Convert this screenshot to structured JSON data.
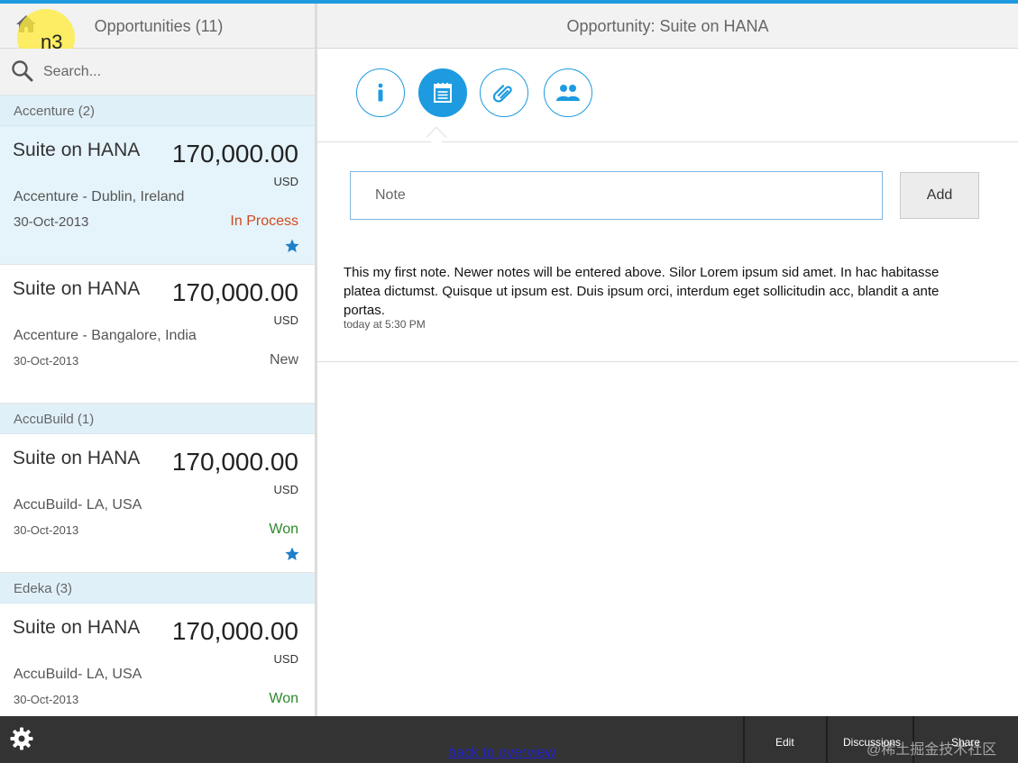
{
  "master": {
    "title": "Opportunities (11)",
    "badge": "n3",
    "search_placeholder": "Search...",
    "groups": [
      {
        "header": "Accenture (2)",
        "items": [
          {
            "title": "Suite on HANA",
            "amount": "170,000.00",
            "currency": "USD",
            "location": "Accenture - Dublin, Ireland",
            "date": "30-Oct-2013",
            "status": "In Process",
            "favorite": true
          },
          {
            "title": "Suite on HANA",
            "amount": "170,000.00",
            "currency": "USD",
            "location": "Accenture - Bangalore, India",
            "date": "30-Oct-2013",
            "status": "New",
            "favorite": false
          }
        ]
      },
      {
        "header": "AccuBuild (1)",
        "items": [
          {
            "title": "Suite on HANA",
            "amount": "170,000.00",
            "currency": "USD",
            "location": "AccuBuild- LA, USA",
            "date": "30-Oct-2013",
            "status": "Won",
            "favorite": true
          }
        ]
      },
      {
        "header": "Edeka (3)",
        "items": [
          {
            "title": "Suite on HANA",
            "amount": "170,000.00",
            "currency": "USD",
            "location": "AccuBuild- LA, USA",
            "date": "30-Oct-2013",
            "status": "Won",
            "favorite": false
          }
        ]
      }
    ]
  },
  "detail": {
    "title": "Opportunity: Suite on HANA",
    "tabs": [
      {
        "icon": "info-icon",
        "active": false
      },
      {
        "icon": "notes-icon",
        "active": true
      },
      {
        "icon": "attachment-icon",
        "active": false
      },
      {
        "icon": "contacts-icon",
        "active": false
      }
    ],
    "note_placeholder": "Note",
    "add_label": "Add",
    "notes": [
      {
        "text": "This my first note. Newer notes will be entered above. Silor Lorem ipsum sid amet. In hac habitasse platea dictumst. Quisque ut ipsum est. Duis ipsum orci, interdum eget sollicitudin acc, blandit a ante portas.",
        "time": "today at 5:30 PM"
      }
    ]
  },
  "footer": {
    "back_link": "back to overview",
    "buttons": [
      "Edit",
      "Discussions",
      "Share"
    ],
    "watermark": "@稀土掘金技术社区"
  },
  "colors": {
    "accent": "#1e9be0",
    "selected_row": "#e5f3fa",
    "group_header": "#e0f0f9",
    "status_in_process": "#d14b1d",
    "status_won": "#2a8a2a",
    "footer": "#333333"
  }
}
